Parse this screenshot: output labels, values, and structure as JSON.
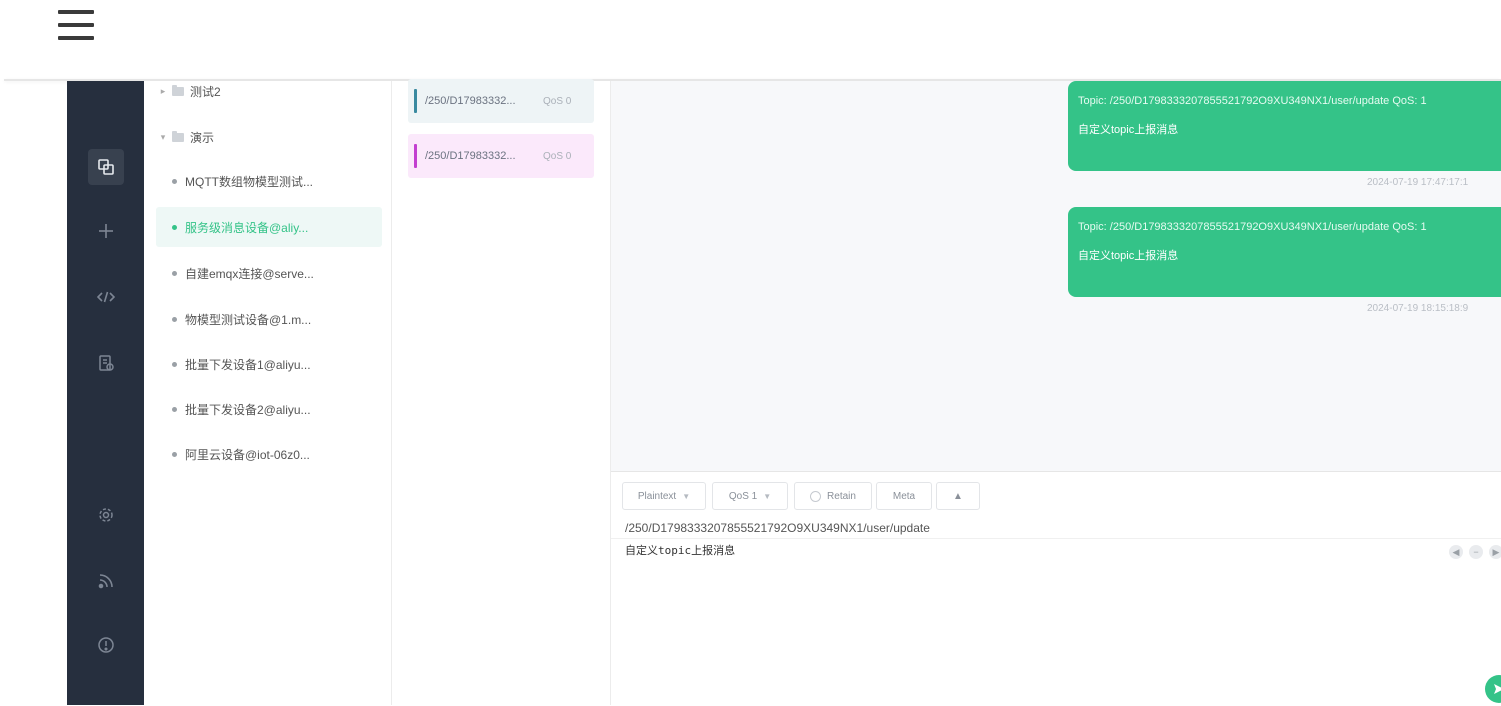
{
  "colors": {
    "accent": "#34c388",
    "sidebar_bg": "#262f3e",
    "topic_bar_1": "#3a8aa0",
    "topic_bar_2": "#c33fd0",
    "topic_bg_1": "#eef4f6",
    "topic_bg_2": "#fbe9fb"
  },
  "icons": {
    "menu": "hamburger-icon",
    "nav": [
      "connections-icon",
      "plus-icon",
      "code-icon",
      "log-icon",
      "gear-icon",
      "feed-icon",
      "info-icon"
    ],
    "send": "send-icon"
  },
  "connections": {
    "groups": [
      {
        "name": "测试2",
        "arrow": "▸"
      },
      {
        "name": "演示",
        "arrow": "▾"
      }
    ],
    "items": [
      {
        "label": "MQTT数组物模型测试..."
      },
      {
        "label": "服务级消息设备@aliy..."
      },
      {
        "label": "自建emqx连接@serve..."
      },
      {
        "label": "物模型测试设备@1.m..."
      },
      {
        "label": "批量下发设备1@aliyu..."
      },
      {
        "label": "批量下发设备2@aliyu..."
      },
      {
        "label": "阿里云设备@iot-06z0..."
      }
    ]
  },
  "topics": [
    {
      "name": "/250/D17983332...",
      "qos": "QoS 0"
    },
    {
      "name": "/250/D17983332...",
      "qos": "QoS 0"
    }
  ],
  "messages": [
    {
      "topic": "Topic: /250/D1798333207855521792O9XU349NX1/user/update   QoS: 1",
      "payload": "自定义topic上报消息",
      "time": "2024-07-19 17:47:17:1"
    },
    {
      "topic": "Topic: /250/D1798333207855521792O9XU349NX1/user/update   QoS: 1",
      "payload": "自定义topic上报消息",
      "time": "2024-07-19 18:15:18:9"
    }
  ],
  "compose": {
    "format": "Plaintext",
    "qos": "QoS 1",
    "retain": "Retain",
    "meta": "Meta",
    "expand": "▲",
    "topic": "/250/D1798333207855521792O9XU349NX1/user/update",
    "payload": "自定义topic上报消息"
  }
}
